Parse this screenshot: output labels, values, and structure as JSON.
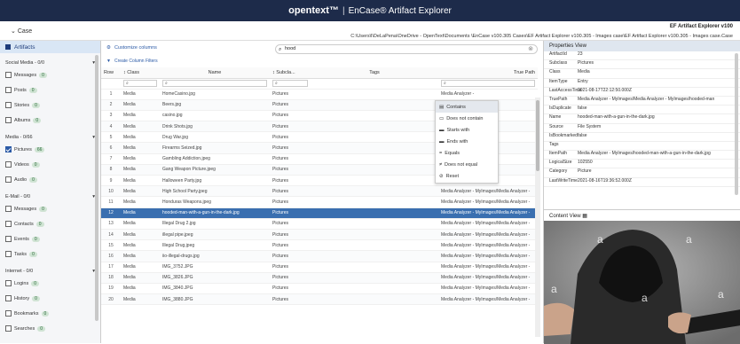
{
  "header": {
    "brand": "opentext™",
    "separator": "|",
    "product": "EnCase® Artifact Explorer"
  },
  "casebar": {
    "case_label": "Case",
    "version": "EF Artifact Explorer v100",
    "path": "C:\\Users\\l\\DeLaPena\\OneDrive - OpenText\\Documents \\EnCase v100.305 Cases\\EF Artifact Explorer v100.305 - Images case\\EF Artifact Explorer v100.305 - Images case.Case"
  },
  "sidebar": {
    "title": "Artifacts",
    "groups": [
      {
        "label": "Social Media - 0/0",
        "items": [
          {
            "label": "Messages",
            "count": "0",
            "checked": false
          },
          {
            "label": "Posts",
            "count": "0",
            "checked": false
          },
          {
            "label": "Stories",
            "count": "0",
            "checked": false
          },
          {
            "label": "Albums",
            "count": "0",
            "checked": false
          }
        ]
      },
      {
        "label": "Media - 0/66",
        "items": [
          {
            "label": "Pictures",
            "count": "66",
            "checked": true
          },
          {
            "label": "Videos",
            "count": "0",
            "checked": false
          },
          {
            "label": "Audio",
            "count": "0",
            "checked": false
          }
        ]
      },
      {
        "label": "E-Mail - 0/0",
        "items": [
          {
            "label": "Messages",
            "count": "0",
            "checked": false
          },
          {
            "label": "Contacts",
            "count": "0",
            "checked": false
          },
          {
            "label": "Events",
            "count": "0",
            "checked": false
          },
          {
            "label": "Tasks",
            "count": "0",
            "checked": false
          }
        ]
      },
      {
        "label": "Internet - 0/0",
        "items": [
          {
            "label": "Logins",
            "count": "0",
            "checked": false
          },
          {
            "label": "History",
            "count": "0",
            "checked": false
          },
          {
            "label": "Bookmarks",
            "count": "0",
            "checked": false
          },
          {
            "label": "Searches",
            "count": "0",
            "checked": false
          }
        ]
      }
    ]
  },
  "toolbar": {
    "customize": "Customize columns",
    "create_filters": "Create Column Filters",
    "search_value": "hood"
  },
  "table": {
    "headers": {
      "row": "Row",
      "class": "Class",
      "name": "Name",
      "subclass": "Subcla...",
      "tags": "Tags",
      "truepath": "True Path"
    },
    "rows": [
      {
        "n": "1",
        "c": "Media",
        "name": "HomeCasino.jpg",
        "sub": "Pictures",
        "tp": "Media Analyzer -"
      },
      {
        "n": "2",
        "c": "Media",
        "name": "Beers.jpg",
        "sub": "Pictures",
        "tp": "Media Analyzer -"
      },
      {
        "n": "3",
        "c": "Media",
        "name": "casino.jpg",
        "sub": "Pictures",
        "tp": "Media Analyzer -"
      },
      {
        "n": "4",
        "c": "Media",
        "name": "Drink Shots.jpg",
        "sub": "Pictures",
        "tp": "Media Analyzer -"
      },
      {
        "n": "5",
        "c": "Media",
        "name": "Drug War.jpg",
        "sub": "Pictures",
        "tp": "Media Analyzer -"
      },
      {
        "n": "6",
        "c": "Media",
        "name": "Firearms Seized.jpg",
        "sub": "Pictures",
        "tp": "Media Analyzer -"
      },
      {
        "n": "7",
        "c": "Media",
        "name": "Gambling Addiction.jpeg",
        "sub": "Pictures",
        "tp": "Media Analyzer -"
      },
      {
        "n": "8",
        "c": "Media",
        "name": "Gang Weapon Picture.jpeg",
        "sub": "Pictures",
        "tp": "Media Analyzer -"
      },
      {
        "n": "9",
        "c": "Media",
        "name": "Halloween Party.jpg",
        "sub": "Pictures",
        "tp": "Media Analyzer -"
      },
      {
        "n": "10",
        "c": "Media",
        "name": "High School Party.jpeg",
        "sub": "Pictures",
        "tp": "Media Analyzer - MyImages/Media Analyzer -"
      },
      {
        "n": "11",
        "c": "Media",
        "name": "Honduras Weapons.jpeg",
        "sub": "Pictures",
        "tp": "Media Analyzer - MyImages/Media Analyzer -"
      },
      {
        "n": "12",
        "c": "Media",
        "name": "hooded-man-with-a-gun-in-the-dark.jpg",
        "sub": "Pictures",
        "tp": "Media Analyzer - MyImages/Media Analyzer -",
        "sel": true
      },
      {
        "n": "13",
        "c": "Media",
        "name": "Illegal Drug 2.jpg",
        "sub": "Pictures",
        "tp": "Media Analyzer - MyImages/Media Analyzer -"
      },
      {
        "n": "14",
        "c": "Media",
        "name": "illegal pipe.jpeg",
        "sub": "Pictures",
        "tp": "Media Analyzer - MyImages/Media Analyzer -"
      },
      {
        "n": "15",
        "c": "Media",
        "name": "Illegal Drug.jpeg",
        "sub": "Pictures",
        "tp": "Media Analyzer - MyImages/Media Analyzer -"
      },
      {
        "n": "16",
        "c": "Media",
        "name": "iio-illegal-drugs.jpg",
        "sub": "Pictures",
        "tp": "Media Analyzer - MyImages/Media Analyzer -"
      },
      {
        "n": "17",
        "c": "Media",
        "name": "IMG_3752.JPG",
        "sub": "Pictures",
        "tp": "Media Analyzer - MyImages/Media Analyzer -"
      },
      {
        "n": "18",
        "c": "Media",
        "name": "IMG_3826.JPG",
        "sub": "Pictures",
        "tp": "Media Analyzer - MyImages/Media Analyzer -"
      },
      {
        "n": "19",
        "c": "Media",
        "name": "IMG_3840.JPG",
        "sub": "Pictures",
        "tp": "Media Analyzer - MyImages/Media Analyzer -"
      },
      {
        "n": "20",
        "c": "Media",
        "name": "IMG_3880.JPG",
        "sub": "Pictures",
        "tp": "Media Analyzer - MyImages/Media Analyzer -"
      }
    ]
  },
  "filter_menu": [
    {
      "icon": "contains-icon",
      "glyph": "▤",
      "label": "Contains"
    },
    {
      "icon": "does-not-contain-icon",
      "glyph": "▭",
      "label": "Does not contain"
    },
    {
      "icon": "starts-with-icon",
      "glyph": "▬",
      "label": "Starts with"
    },
    {
      "icon": "ends-with-icon",
      "glyph": "▬",
      "label": "Ends with"
    },
    {
      "icon": "equals-icon",
      "glyph": "=",
      "label": "Equals"
    },
    {
      "icon": "not-equal-icon",
      "glyph": "≠",
      "label": "Does not equal"
    },
    {
      "icon": "reset-icon",
      "glyph": "⊘",
      "label": "Reset"
    }
  ],
  "properties": {
    "title": "Properties View",
    "rows": [
      [
        "ArtifactId",
        "23"
      ],
      [
        "Subclass",
        "Pictures"
      ],
      [
        "Class",
        "Media"
      ],
      [
        "ItemType",
        "Entry"
      ],
      [
        "LastAccessTime",
        "2021-08-17T22:12:50.000Z"
      ],
      [
        "TruePath",
        "Media Analyzer - MyImages/Media Analyzer - MyImages/hooded-man"
      ],
      [
        "IsDuplicate",
        "false"
      ],
      [
        "Name",
        "hooded-man-with-a-gun-in-the-dark.jpg"
      ],
      [
        "Source",
        "File System"
      ],
      [
        "IsBookmarked",
        "false"
      ],
      [
        "Tags",
        ""
      ],
      [
        "ItemPath",
        "Media Analyzer - MyImages/hooded-man-with-a-gun-in-the-dark.jpg"
      ],
      [
        "LogicalSize",
        "102550"
      ],
      [
        "Category",
        "Picture"
      ],
      [
        "LastWriteTime",
        "2021-08-16T19:36:52.000Z"
      ]
    ]
  },
  "content": {
    "title": "Content View",
    "watermark": "a"
  },
  "colors": {
    "header_bg": "#1d2b4a",
    "selection": "#3a6fb0",
    "link": "#2b5aa6"
  }
}
